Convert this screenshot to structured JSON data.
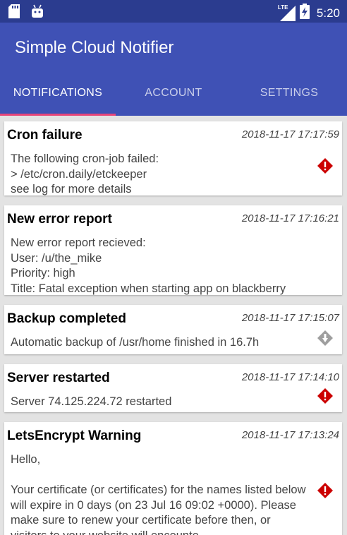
{
  "status_bar": {
    "icons": [
      "sd-card-icon",
      "android-icon",
      "lte-signal-icon",
      "battery-charging-icon"
    ],
    "network_label": "LTE",
    "time": "5:20"
  },
  "app": {
    "title": "Simple Cloud Notifier",
    "primary_color": "#3f51b5",
    "status_bar_color": "#2b3c8f",
    "accent_color": "#e6457a"
  },
  "tabs": [
    {
      "label": "NOTIFICATIONS",
      "active": true
    },
    {
      "label": "ACCOUNT",
      "active": false
    },
    {
      "label": "SETTINGS",
      "active": false
    }
  ],
  "notifications": [
    {
      "title": "Cron failure",
      "time": "2018-11-17 17:17:59",
      "body": "The following cron-job failed:\n>  /etc/cron.daily/etckeeper\nsee log for more details",
      "priority_icon": "error-diamond-icon",
      "priority_color": "#cc0000"
    },
    {
      "title": "New error report",
      "time": "2018-11-17 17:16:21",
      "body": "New error report recieved:\nUser: /u/the_mike\nPriority: high\nTitle: Fatal exception when starting app on blackberry",
      "priority_icon": "",
      "priority_color": ""
    },
    {
      "title": "Backup completed",
      "time": "2018-11-17 17:15:07",
      "body": "Automatic backup of /usr/home finished in 16.7h",
      "priority_icon": "low-priority-diamond-icon",
      "priority_color": "#9e9e9e"
    },
    {
      "title": "Server restarted",
      "time": "2018-11-17 17:14:10",
      "body": "Server 74.125.224.72 restarted",
      "priority_icon": "error-diamond-icon",
      "priority_color": "#cc0000"
    },
    {
      "title": "LetsEncrypt Warning",
      "time": "2018-11-17 17:13:24",
      "body": "Hello,\n\nYour certificate (or certificates) for the names listed below will expire in 0 days (on 23 Jul 16 09:02 +0000). Please make sure to renew your certificate before then, or visitors to your website will encounte…",
      "priority_icon": "error-diamond-icon",
      "priority_color": "#cc0000"
    }
  ]
}
